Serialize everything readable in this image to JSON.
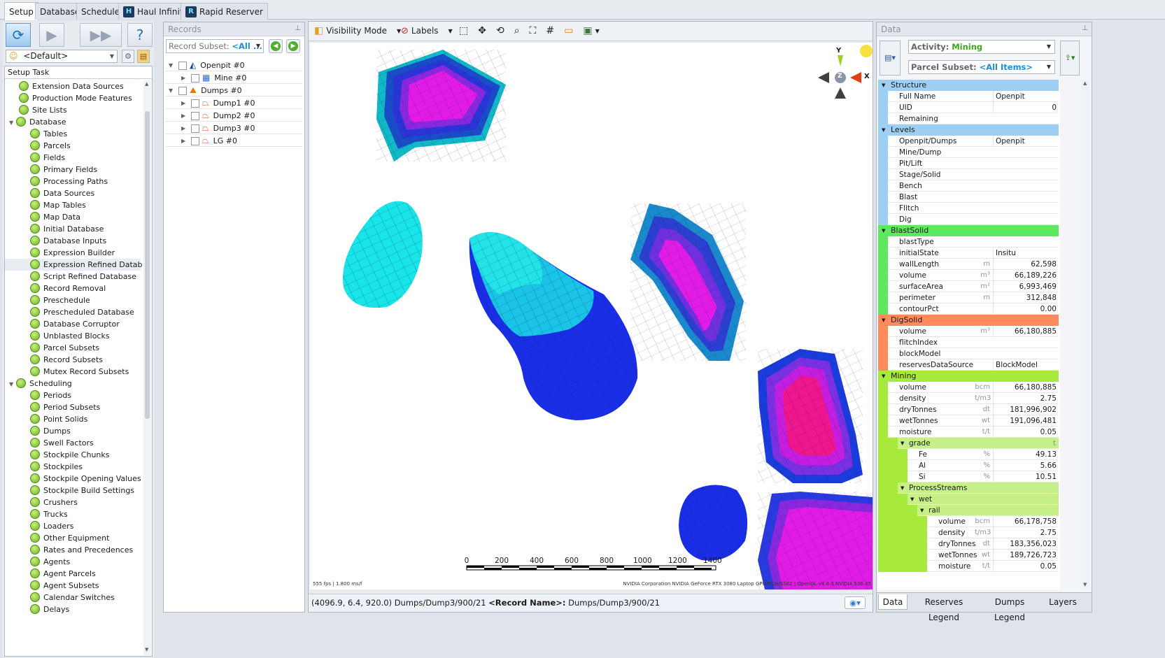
{
  "tabs": [
    "Setup",
    "Database",
    "Schedule",
    "Haul Infinity",
    "Rapid Reserver"
  ],
  "setup_panel": {
    "profile": "<Default>",
    "task_header": "Setup Task",
    "tasks": [
      {
        "label": "Extension Data Sources",
        "level": 1
      },
      {
        "label": "Production Mode Features",
        "level": 1
      },
      {
        "label": "Site Lists",
        "level": 1
      },
      {
        "label": "Database",
        "level": 0,
        "expanded": true
      },
      {
        "label": "Tables",
        "level": 2
      },
      {
        "label": "Parcels",
        "level": 2
      },
      {
        "label": "Fields",
        "level": 2
      },
      {
        "label": "Primary Fields",
        "level": 2
      },
      {
        "label": "Processing Paths",
        "level": 2
      },
      {
        "label": "Data Sources",
        "level": 2
      },
      {
        "label": "Map Tables",
        "level": 2
      },
      {
        "label": "Map Data",
        "level": 2
      },
      {
        "label": "Initial Database",
        "level": 2
      },
      {
        "label": "Database Inputs",
        "level": 2
      },
      {
        "label": "Expression Builder",
        "level": 2
      },
      {
        "label": "Expression Refined Database",
        "level": 2,
        "selected": true
      },
      {
        "label": "Script Refined Database",
        "level": 2
      },
      {
        "label": "Record Removal",
        "level": 2
      },
      {
        "label": "Preschedule",
        "level": 2
      },
      {
        "label": "Prescheduled Database",
        "level": 2
      },
      {
        "label": "Database Corruptor",
        "level": 2
      },
      {
        "label": "Unblasted Blocks",
        "level": 2
      },
      {
        "label": "Parcel Subsets",
        "level": 2
      },
      {
        "label": "Record Subsets",
        "level": 2
      },
      {
        "label": "Mutex Record Subsets",
        "level": 2
      },
      {
        "label": "Scheduling",
        "level": 0,
        "expanded": true
      },
      {
        "label": "Periods",
        "level": 2
      },
      {
        "label": "Period Subsets",
        "level": 2
      },
      {
        "label": "Point Solids",
        "level": 2
      },
      {
        "label": "Dumps",
        "level": 2
      },
      {
        "label": "Swell Factors",
        "level": 2
      },
      {
        "label": "Stockpile Chunks",
        "level": 2
      },
      {
        "label": "Stockpiles",
        "level": 2
      },
      {
        "label": "Stockpile Opening Values",
        "level": 2
      },
      {
        "label": "Stockpile Build Settings",
        "level": 2
      },
      {
        "label": "Crushers",
        "level": 2
      },
      {
        "label": "Trucks",
        "level": 2
      },
      {
        "label": "Loaders",
        "level": 2
      },
      {
        "label": "Other Equipment",
        "level": 2
      },
      {
        "label": "Rates and Precedences",
        "level": 2
      },
      {
        "label": "Agents",
        "level": 2
      },
      {
        "label": "Agent Parcels",
        "level": 2
      },
      {
        "label": "Agent Subsets",
        "level": 2
      },
      {
        "label": "Calendar Switches",
        "level": 2
      },
      {
        "label": "Delays",
        "level": 2
      }
    ]
  },
  "records_panel": {
    "title": "Records",
    "subset_label": "Record Subset:",
    "subset_value": "<All ...",
    "items": [
      {
        "label": "Openpit #0",
        "level": 0,
        "icon": "openpit-icon",
        "expander": "open"
      },
      {
        "label": "Mine #0",
        "level": 1,
        "icon": "mine-icon",
        "expander": "closed"
      },
      {
        "label": "Dumps #0",
        "level": 0,
        "icon": "dumps-icon",
        "expander": "open"
      },
      {
        "label": "Dump1 #0",
        "level": 1,
        "icon": "dump-icon",
        "expander": "closed"
      },
      {
        "label": "Dump2 #0",
        "level": 1,
        "icon": "dump-icon",
        "expander": "closed"
      },
      {
        "label": "Dump3 #0",
        "level": 1,
        "icon": "dump-icon",
        "expander": "closed"
      },
      {
        "label": "LG #0",
        "level": 1,
        "icon": "dump-icon",
        "expander": "closed"
      }
    ]
  },
  "viewport": {
    "visibility_mode": "Visibility Mode",
    "labels": "Labels",
    "axis_y": "Y",
    "axis_z": "Z",
    "axis_x": "X",
    "scale_ticks": [
      "0",
      "200",
      "400",
      "600",
      "800",
      "1000",
      "1200",
      "1400"
    ],
    "fps_text": "555 fps | 1.800 ms/f",
    "gpu_text": "NVIDIA Corporation NVIDIA GeForce RTX 3080 Laptop GPU/PCIe/SSE2 | OpenGL v4.6.0 NVIDIA 536.45",
    "status_coords": "(4096.9, 6.4, 920.0) Dumps/Dump3/900/21",
    "status_record_label": "<Record Name>:",
    "status_record_value": "Dumps/Dump3/900/21"
  },
  "data_panel": {
    "title": "Data",
    "activity_label": "Activity:",
    "activity_value": "Mining",
    "parcel_label": "Parcel Subset:",
    "parcel_value": "<All Items>",
    "rows": [
      {
        "kind": "section",
        "label": "Structure",
        "color": "#9ccff2"
      },
      {
        "kind": "row",
        "name": "Full Name",
        "unit": "",
        "value": "Openpit",
        "align": "left",
        "indent": 0,
        "band": "#9ccff2"
      },
      {
        "kind": "row",
        "name": "UID",
        "unit": "",
        "value": "0",
        "align": "right",
        "indent": 0,
        "band": "#9ccff2"
      },
      {
        "kind": "row",
        "name": "Remaining",
        "unit": "",
        "value": "",
        "align": "right",
        "indent": 0,
        "band": "#9ccff2"
      },
      {
        "kind": "section",
        "label": "Levels",
        "color": "#9ccff2"
      },
      {
        "kind": "row",
        "name": "Openpit/Dumps",
        "unit": "",
        "value": "Openpit",
        "align": "left",
        "indent": 0,
        "band": "#9ccff2"
      },
      {
        "kind": "row",
        "name": "Mine/Dump",
        "unit": "",
        "value": "",
        "align": "left",
        "indent": 0,
        "band": "#9ccff2"
      },
      {
        "kind": "row",
        "name": "Pit/Lift",
        "unit": "",
        "value": "",
        "align": "left",
        "indent": 0,
        "band": "#9ccff2"
      },
      {
        "kind": "row",
        "name": "Stage/Solid",
        "unit": "",
        "value": "",
        "align": "left",
        "indent": 0,
        "band": "#9ccff2"
      },
      {
        "kind": "row",
        "name": "Bench",
        "unit": "",
        "value": "",
        "align": "left",
        "indent": 0,
        "band": "#9ccff2"
      },
      {
        "kind": "row",
        "name": "Blast",
        "unit": "",
        "value": "",
        "align": "left",
        "indent": 0,
        "band": "#9ccff2"
      },
      {
        "kind": "row",
        "name": "Flitch",
        "unit": "",
        "value": "",
        "align": "left",
        "indent": 0,
        "band": "#9ccff2"
      },
      {
        "kind": "row",
        "name": "Dig",
        "unit": "",
        "value": "",
        "align": "left",
        "indent": 0,
        "band": "#9ccff2"
      },
      {
        "kind": "section",
        "label": "BlastSolid",
        "color": "#5ee85e"
      },
      {
        "kind": "row",
        "name": "blastType",
        "unit": "",
        "value": "",
        "align": "left",
        "indent": 0,
        "band": "#5ee85e"
      },
      {
        "kind": "row",
        "name": "initialState",
        "unit": "",
        "value": "Insitu",
        "align": "left",
        "indent": 0,
        "band": "#5ee85e"
      },
      {
        "kind": "row",
        "name": "wallLength",
        "unit": "m",
        "value": "62,598",
        "align": "right",
        "indent": 0,
        "band": "#5ee85e"
      },
      {
        "kind": "row",
        "name": "volume",
        "unit": "m³",
        "value": "66,189,226",
        "align": "right",
        "indent": 0,
        "band": "#5ee85e"
      },
      {
        "kind": "row",
        "name": "surfaceArea",
        "unit": "m²",
        "value": "6,993,469",
        "align": "right",
        "indent": 0,
        "band": "#5ee85e"
      },
      {
        "kind": "row",
        "name": "perimeter",
        "unit": "m",
        "value": "312,848",
        "align": "right",
        "indent": 0,
        "band": "#5ee85e"
      },
      {
        "kind": "row",
        "name": "contourPct",
        "unit": "",
        "value": "0.00",
        "align": "right",
        "indent": 0,
        "band": "#5ee85e"
      },
      {
        "kind": "section",
        "label": "DigSolid",
        "color": "#ff8a5c"
      },
      {
        "kind": "row",
        "name": "volume",
        "unit": "m³",
        "value": "66,180,885",
        "align": "right",
        "indent": 0,
        "band": "#ff8a5c"
      },
      {
        "kind": "row",
        "name": "flitchIndex",
        "unit": "",
        "value": "",
        "align": "left",
        "indent": 0,
        "band": "#ff8a5c"
      },
      {
        "kind": "row",
        "name": "blockModel",
        "unit": "",
        "value": "",
        "align": "left",
        "indent": 0,
        "band": "#ff8a5c"
      },
      {
        "kind": "row",
        "name": "reservesDataSource",
        "unit": "",
        "value": "BlockModel",
        "align": "left",
        "indent": 0,
        "band": "#ff8a5c"
      },
      {
        "kind": "section",
        "label": "Mining",
        "color": "#a8ea3c"
      },
      {
        "kind": "row",
        "name": "volume",
        "unit": "bcm",
        "value": "66,180,885",
        "align": "right",
        "indent": 0,
        "band": "#a8ea3c"
      },
      {
        "kind": "row",
        "name": "density",
        "unit": "t/m3",
        "value": "2.75",
        "align": "right",
        "indent": 0,
        "band": "#a8ea3c"
      },
      {
        "kind": "row",
        "name": "dryTonnes",
        "unit": "dt",
        "value": "181,996,902",
        "align": "right",
        "indent": 0,
        "band": "#a8ea3c"
      },
      {
        "kind": "row",
        "name": "wetTonnes",
        "unit": "wt",
        "value": "191,096,481",
        "align": "right",
        "indent": 0,
        "band": "#a8ea3c"
      },
      {
        "kind": "row",
        "name": "moisture",
        "unit": "t/t",
        "value": "0.05",
        "align": "right",
        "indent": 0,
        "band": "#a8ea3c"
      },
      {
        "kind": "subsection",
        "label": "grade",
        "unit": "t",
        "indent": 1,
        "band": "#a8ea3c"
      },
      {
        "kind": "row",
        "name": "Fe",
        "unit": "%",
        "value": "49.13",
        "align": "right",
        "indent": 2,
        "band": "#a8ea3c"
      },
      {
        "kind": "row",
        "name": "Al",
        "unit": "%",
        "value": "5.66",
        "align": "right",
        "indent": 2,
        "band": "#a8ea3c"
      },
      {
        "kind": "row",
        "name": "Si",
        "unit": "%",
        "value": "10.51",
        "align": "right",
        "indent": 2,
        "band": "#a8ea3c"
      },
      {
        "kind": "subsection",
        "label": "ProcessStreams",
        "unit": "",
        "indent": 1,
        "band": "#a8ea3c"
      },
      {
        "kind": "subsection",
        "label": "wet",
        "unit": "",
        "indent": 2,
        "band": "#a8ea3c"
      },
      {
        "kind": "subsection",
        "label": "rail",
        "unit": "",
        "indent": 3,
        "band": "#a8ea3c"
      },
      {
        "kind": "row",
        "name": "volume",
        "unit": "bcm",
        "value": "66,178,758",
        "align": "right",
        "indent": 4,
        "band": "#a8ea3c"
      },
      {
        "kind": "row",
        "name": "density",
        "unit": "t/m3",
        "value": "2.75",
        "align": "right",
        "indent": 4,
        "band": "#a8ea3c"
      },
      {
        "kind": "row",
        "name": "dryTonnes",
        "unit": "dt",
        "value": "183,356,023",
        "align": "right",
        "indent": 4,
        "band": "#a8ea3c"
      },
      {
        "kind": "row",
        "name": "wetTonnes",
        "unit": "wt",
        "value": "189,726,723",
        "align": "right",
        "indent": 4,
        "band": "#a8ea3c"
      },
      {
        "kind": "row",
        "name": "moisture",
        "unit": "t/t",
        "value": "0.05",
        "align": "right",
        "indent": 4,
        "band": "#a8ea3c"
      }
    ],
    "bottom_tabs": [
      "Data",
      "Reserves Legend",
      "Dumps Legend",
      "Layers"
    ]
  }
}
